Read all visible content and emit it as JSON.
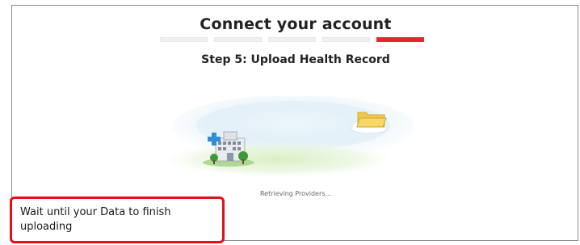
{
  "header": {
    "title": "Connect your account",
    "subtitle": "Step 5: Upload Health Record"
  },
  "progress": {
    "total_steps": 5,
    "current_step": 5,
    "active_color": "#e0282e"
  },
  "illustration": {
    "left_icon": "hospital-icon",
    "right_icon": "folder-cloud-icon"
  },
  "status": {
    "text": "Retrieving Providers..."
  },
  "callout": {
    "text": "Wait until your Data to finish uploading",
    "border_color": "#e2101a"
  }
}
